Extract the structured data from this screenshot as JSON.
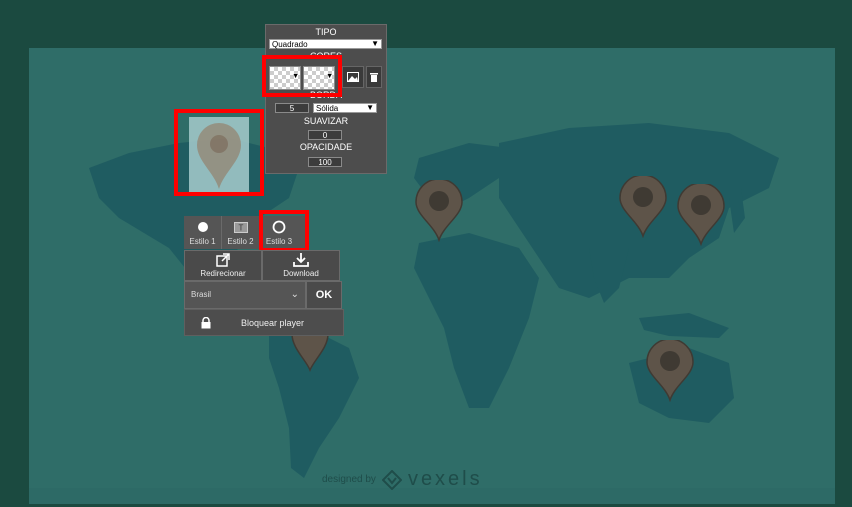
{
  "tipo_panel": {
    "tipo_label": "TIPO",
    "tipo_value": "Quadrado",
    "cores_label": "CORES",
    "borda_label": "BORDA",
    "borda_width": "5",
    "borda_style": "Sólida",
    "suavizar_label": "SUAVIZAR",
    "suavizar_value": "0",
    "opacidade_label": "OPACIDADE",
    "opacidade_value": "100"
  },
  "styles": [
    {
      "label": "Estilo 1",
      "icon": "filled-circle-icon"
    },
    {
      "label": "Estilo 2",
      "icon": "text-box-icon"
    },
    {
      "label": "Estilo 3",
      "icon": "ring-icon"
    }
  ],
  "actions": {
    "redirect_label": "Redirecionar",
    "download_label": "Download"
  },
  "country": {
    "selected": "Brasil",
    "ok_label": "OK"
  },
  "lock": {
    "label": "Bloquear player"
  },
  "watermark": {
    "prefix": "designed by",
    "brand": "vexels"
  },
  "colors": {
    "background": "#1b4a40",
    "map": "#2f6d68",
    "land": "#1f5c61",
    "pin": "#5e5449",
    "highlight": "#ff0000",
    "panel": "#4d4d4d"
  }
}
